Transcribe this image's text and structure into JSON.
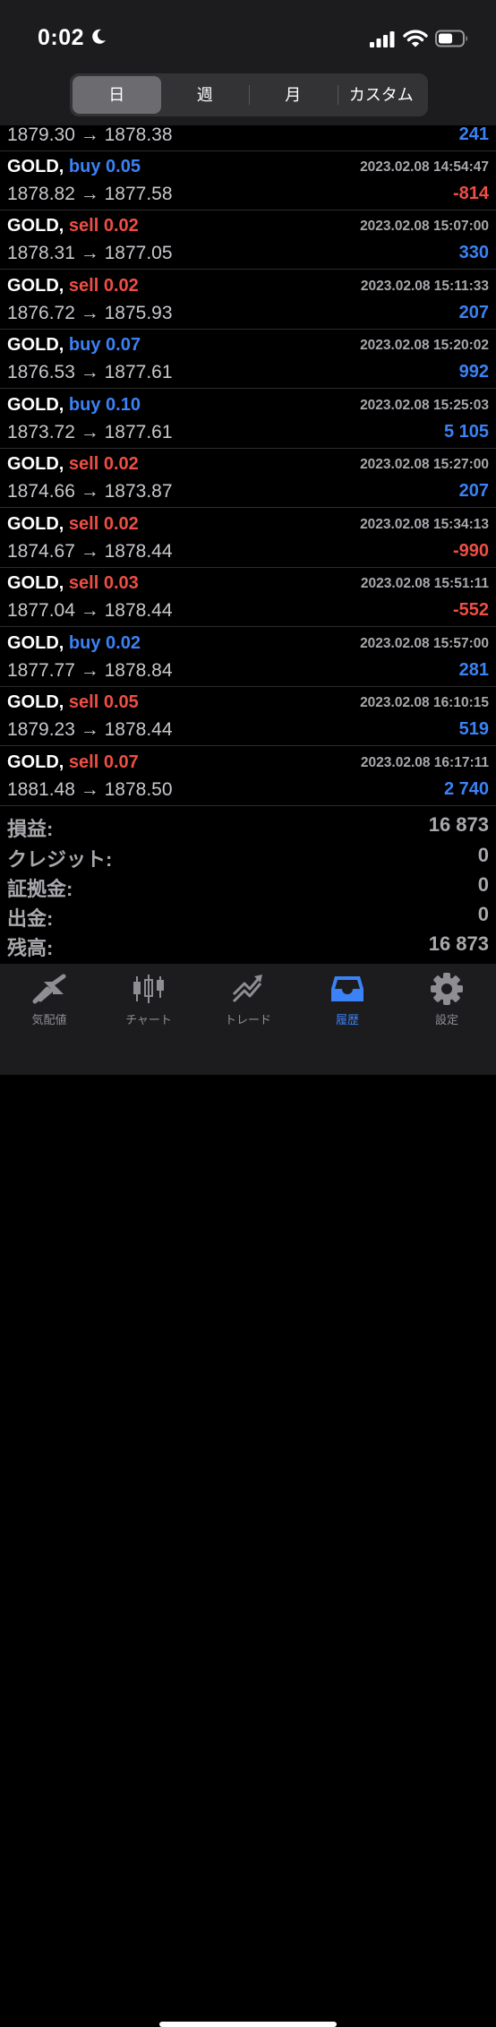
{
  "status_bar": {
    "time": "0:02"
  },
  "period_tabs": [
    {
      "label": "日",
      "active": true
    },
    {
      "label": "週",
      "active": false
    },
    {
      "label": "月",
      "active": false
    },
    {
      "label": "カスタム",
      "active": false
    }
  ],
  "trades": [
    {
      "symbol": "",
      "side": "",
      "volume": "",
      "datetime": "",
      "open": "1879.30",
      "close": "1878.38",
      "arrow": "→",
      "profit": "241",
      "profit_sign": "pos"
    },
    {
      "symbol": "GOLD,",
      "side": "buy",
      "volume": "0.05",
      "datetime": "2023.02.08 14:54:47",
      "open": "1878.82",
      "close": "1877.58",
      "arrow": "→",
      "profit": "-814",
      "profit_sign": "neg"
    },
    {
      "symbol": "GOLD,",
      "side": "sell",
      "volume": "0.02",
      "datetime": "2023.02.08 15:07:00",
      "open": "1878.31",
      "close": "1877.05",
      "arrow": "→",
      "profit": "330",
      "profit_sign": "pos"
    },
    {
      "symbol": "GOLD,",
      "side": "sell",
      "volume": "0.02",
      "datetime": "2023.02.08 15:11:33",
      "open": "1876.72",
      "close": "1875.93",
      "arrow": "→",
      "profit": "207",
      "profit_sign": "pos"
    },
    {
      "symbol": "GOLD,",
      "side": "buy",
      "volume": "0.07",
      "datetime": "2023.02.08 15:20:02",
      "open": "1876.53",
      "close": "1877.61",
      "arrow": "→",
      "profit": "992",
      "profit_sign": "pos"
    },
    {
      "symbol": "GOLD,",
      "side": "buy",
      "volume": "0.10",
      "datetime": "2023.02.08 15:25:03",
      "open": "1873.72",
      "close": "1877.61",
      "arrow": "→",
      "profit": "5 105",
      "profit_sign": "pos"
    },
    {
      "symbol": "GOLD,",
      "side": "sell",
      "volume": "0.02",
      "datetime": "2023.02.08 15:27:00",
      "open": "1874.66",
      "close": "1873.87",
      "arrow": "→",
      "profit": "207",
      "profit_sign": "pos"
    },
    {
      "symbol": "GOLD,",
      "side": "sell",
      "volume": "0.02",
      "datetime": "2023.02.08 15:34:13",
      "open": "1874.67",
      "close": "1878.44",
      "arrow": "→",
      "profit": "-990",
      "profit_sign": "neg"
    },
    {
      "symbol": "GOLD,",
      "side": "sell",
      "volume": "0.03",
      "datetime": "2023.02.08 15:51:11",
      "open": "1877.04",
      "close": "1878.44",
      "arrow": "→",
      "profit": "-552",
      "profit_sign": "neg"
    },
    {
      "symbol": "GOLD,",
      "side": "buy",
      "volume": "0.02",
      "datetime": "2023.02.08 15:57:00",
      "open": "1877.77",
      "close": "1878.84",
      "arrow": "→",
      "profit": "281",
      "profit_sign": "pos"
    },
    {
      "symbol": "GOLD,",
      "side": "sell",
      "volume": "0.05",
      "datetime": "2023.02.08 16:10:15",
      "open": "1879.23",
      "close": "1878.44",
      "arrow": "→",
      "profit": "519",
      "profit_sign": "pos"
    },
    {
      "symbol": "GOLD,",
      "side": "sell",
      "volume": "0.07",
      "datetime": "2023.02.08 16:17:11",
      "open": "1881.48",
      "close": "1878.50",
      "arrow": "→",
      "profit": "2 740",
      "profit_sign": "pos"
    }
  ],
  "summary": [
    {
      "label": "損益:",
      "value": "16 873"
    },
    {
      "label": "クレジット:",
      "value": "0"
    },
    {
      "label": "証拠金:",
      "value": "0"
    },
    {
      "label": "出金:",
      "value": "0"
    },
    {
      "label": "残高:",
      "value": "16 873"
    }
  ],
  "bottom_tabs": [
    {
      "label": "気配値",
      "icon": "quotes-icon",
      "active": false
    },
    {
      "label": "チャート",
      "icon": "chart-icon",
      "active": false
    },
    {
      "label": "トレード",
      "icon": "trade-icon",
      "active": false
    },
    {
      "label": "履歴",
      "icon": "history-icon",
      "active": true
    },
    {
      "label": "設定",
      "icon": "settings-icon",
      "active": false
    }
  ],
  "colors": {
    "buy": "#3b82f6",
    "sell": "#ef4e45",
    "active_tab": "#3b82f6",
    "inactive_tab": "#8e8e93"
  }
}
